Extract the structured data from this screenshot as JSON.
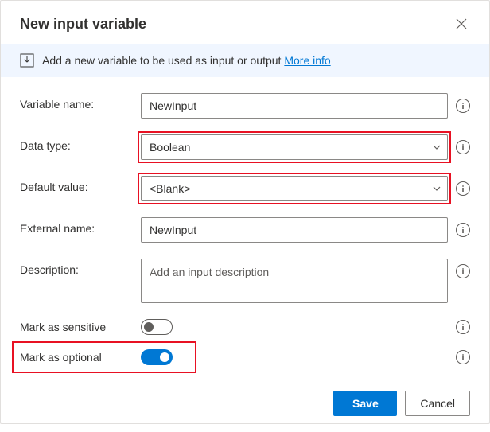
{
  "dialog": {
    "title": "New input variable",
    "banner_text": "Add a new variable to be used as input or output",
    "banner_link": "More info"
  },
  "labels": {
    "variable_name": "Variable name:",
    "data_type": "Data type:",
    "default_value": "Default value:",
    "external_name": "External name:",
    "description": "Description:",
    "mark_sensitive": "Mark as sensitive",
    "mark_optional": "Mark as optional"
  },
  "values": {
    "variable_name": "NewInput",
    "data_type": "Boolean",
    "default_value": "<Blank>",
    "external_name": "NewInput",
    "description": "",
    "description_placeholder": "Add an input description",
    "mark_sensitive": false,
    "mark_optional": true
  },
  "footer": {
    "save": "Save",
    "cancel": "Cancel"
  }
}
